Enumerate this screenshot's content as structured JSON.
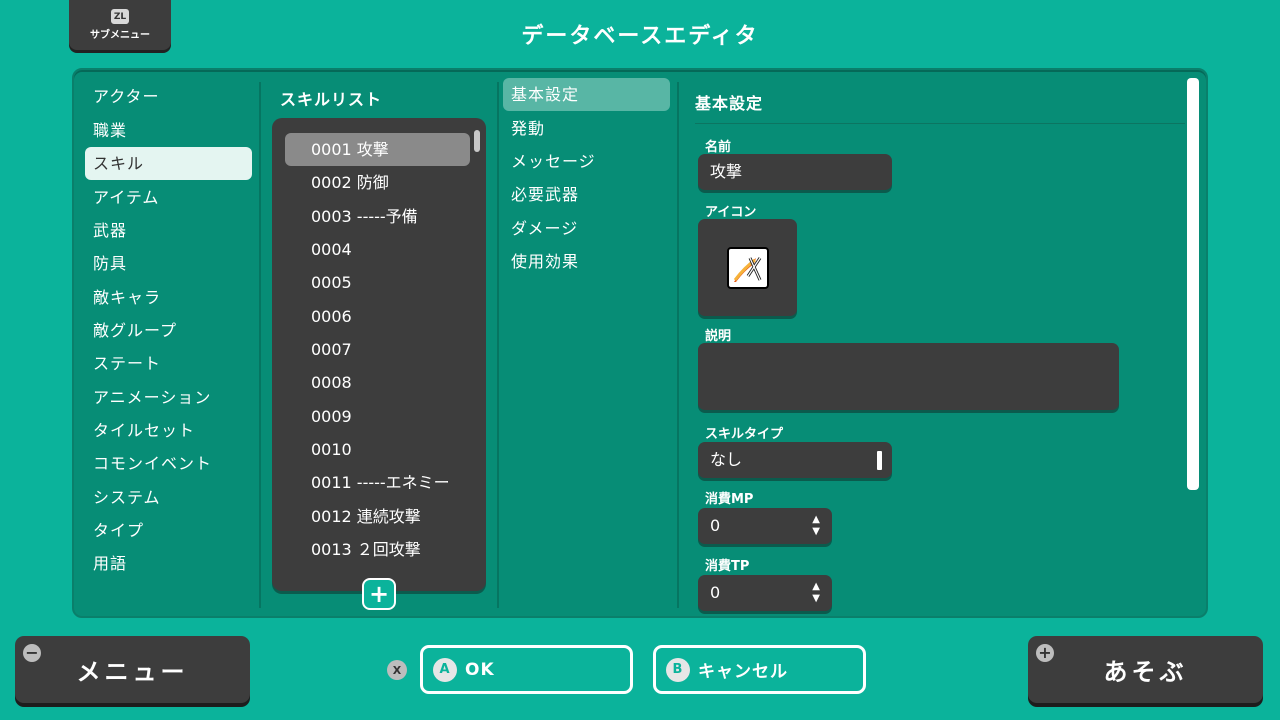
{
  "header": {
    "submenu_button_badge": "ZL",
    "submenu_button_label": "サブメニュー",
    "title": "データベースエディタ"
  },
  "categories": [
    {
      "label": "アクター",
      "selected": false
    },
    {
      "label": "職業",
      "selected": false
    },
    {
      "label": "スキル",
      "selected": true
    },
    {
      "label": "アイテム",
      "selected": false
    },
    {
      "label": "武器",
      "selected": false
    },
    {
      "label": "防具",
      "selected": false
    },
    {
      "label": "敵キャラ",
      "selected": false
    },
    {
      "label": "敵グループ",
      "selected": false
    },
    {
      "label": "ステート",
      "selected": false
    },
    {
      "label": "アニメーション",
      "selected": false
    },
    {
      "label": "タイルセット",
      "selected": false
    },
    {
      "label": "コモンイベント",
      "selected": false
    },
    {
      "label": "システム",
      "selected": false
    },
    {
      "label": "タイプ",
      "selected": false
    },
    {
      "label": "用語",
      "selected": false
    }
  ],
  "skill_list": {
    "title": "スキルリスト",
    "items": [
      {
        "label": "0001 攻撃",
        "selected": true
      },
      {
        "label": "0002 防御",
        "selected": false
      },
      {
        "label": "0003 -----予備",
        "selected": false
      },
      {
        "label": "0004",
        "selected": false
      },
      {
        "label": "0005",
        "selected": false
      },
      {
        "label": "0006",
        "selected": false
      },
      {
        "label": "0007",
        "selected": false
      },
      {
        "label": "0008",
        "selected": false
      },
      {
        "label": "0009",
        "selected": false
      },
      {
        "label": "0010",
        "selected": false
      },
      {
        "label": "0011 -----エネミー",
        "selected": false
      },
      {
        "label": "0012 連続攻撃",
        "selected": false
      },
      {
        "label": "0013 ２回攻撃",
        "selected": false
      }
    ],
    "add_button": "+"
  },
  "tabs": [
    {
      "label": "基本設定",
      "selected": true
    },
    {
      "label": "発動",
      "selected": false
    },
    {
      "label": "メッセージ",
      "selected": false
    },
    {
      "label": "必要武器",
      "selected": false
    },
    {
      "label": "ダメージ",
      "selected": false
    },
    {
      "label": "使用効果",
      "selected": false
    }
  ],
  "detail": {
    "title": "基本設定",
    "name_label": "名前",
    "name_value": "攻撃",
    "icon_label": "アイコン",
    "icon_name": "sword-slash-icon",
    "description_label": "説明",
    "description_value": "",
    "skill_type_label": "スキルタイプ",
    "skill_type_value": "なし",
    "mp_cost_label": "消費MP",
    "mp_cost_value": "0",
    "tp_cost_label": "消費TP",
    "tp_cost_value": "0"
  },
  "bottom": {
    "menu_label": "メニュー",
    "menu_corner": "−",
    "x_hint": "X",
    "ok_badge": "A",
    "ok_label": "OK",
    "cancel_badge": "B",
    "cancel_label": "キャンセル",
    "play_label": "あそぶ",
    "play_corner": "+"
  },
  "colors": {
    "background": "#0bb39b",
    "panel": "#078d76",
    "dark_box": "#3d3d3d",
    "selected_category": "#e4f5f1",
    "selected_tab": "#58b6a5"
  }
}
